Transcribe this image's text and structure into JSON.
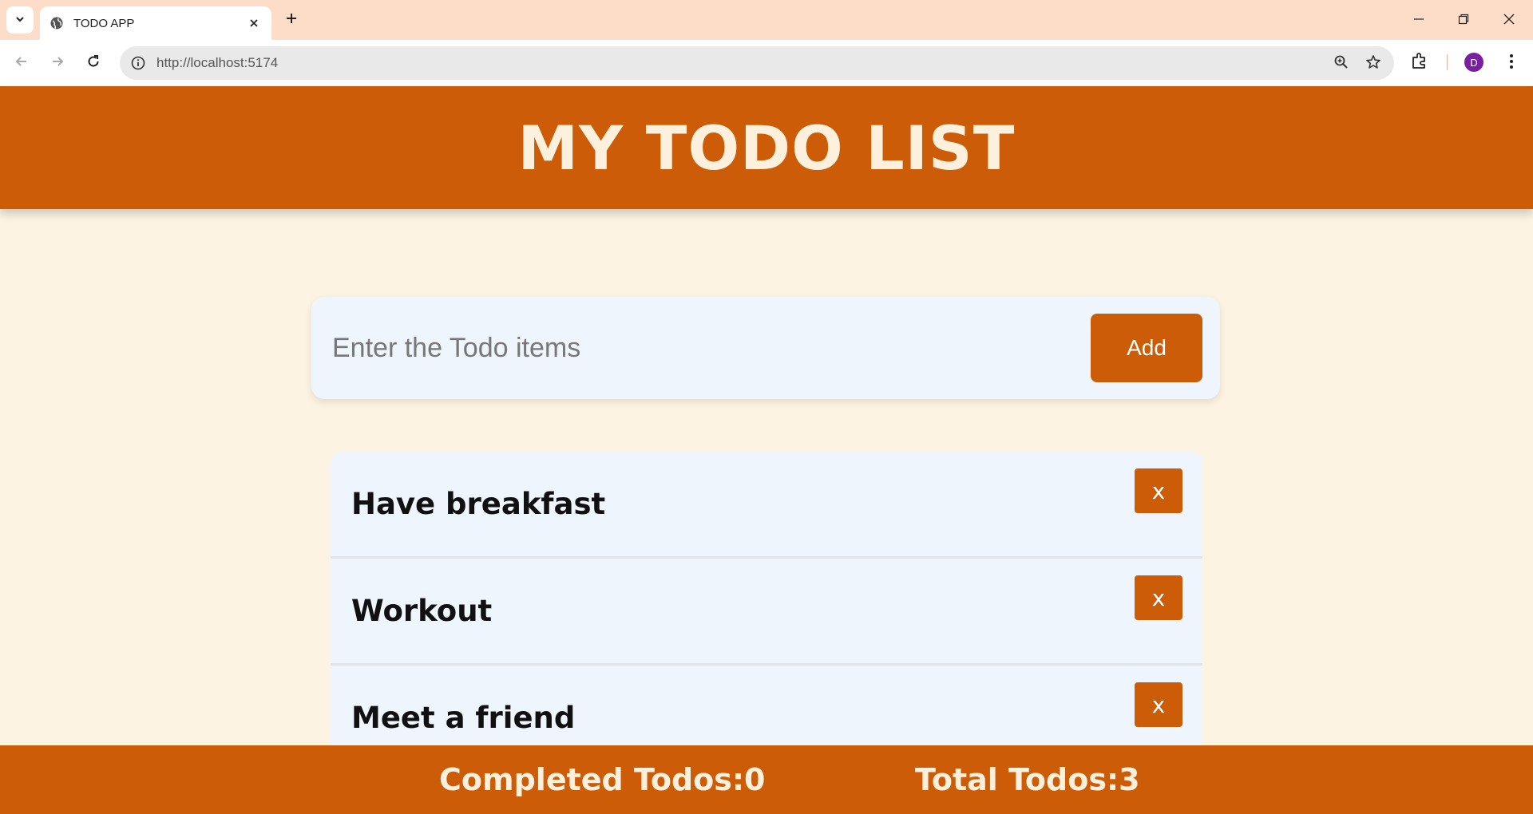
{
  "browser": {
    "tab_title": "TODO APP",
    "url": "http://localhost:5174",
    "profile_initial": "D"
  },
  "header": {
    "title": "MY TODO LIST"
  },
  "input": {
    "placeholder": "Enter the Todo items",
    "value": "",
    "add_label": "Add"
  },
  "todos": [
    {
      "text": "Have breakfast",
      "delete_label": "x"
    },
    {
      "text": "Workout",
      "delete_label": "x"
    },
    {
      "text": "Meet a friend",
      "delete_label": "x"
    }
  ],
  "footer": {
    "completed": "Completed Todos:0",
    "total": "Total Todos:3"
  },
  "colors": {
    "primary": "#cc5c08",
    "background": "#fdf3e2",
    "card": "#eef5fc",
    "header_text": "#fdf0dc"
  }
}
